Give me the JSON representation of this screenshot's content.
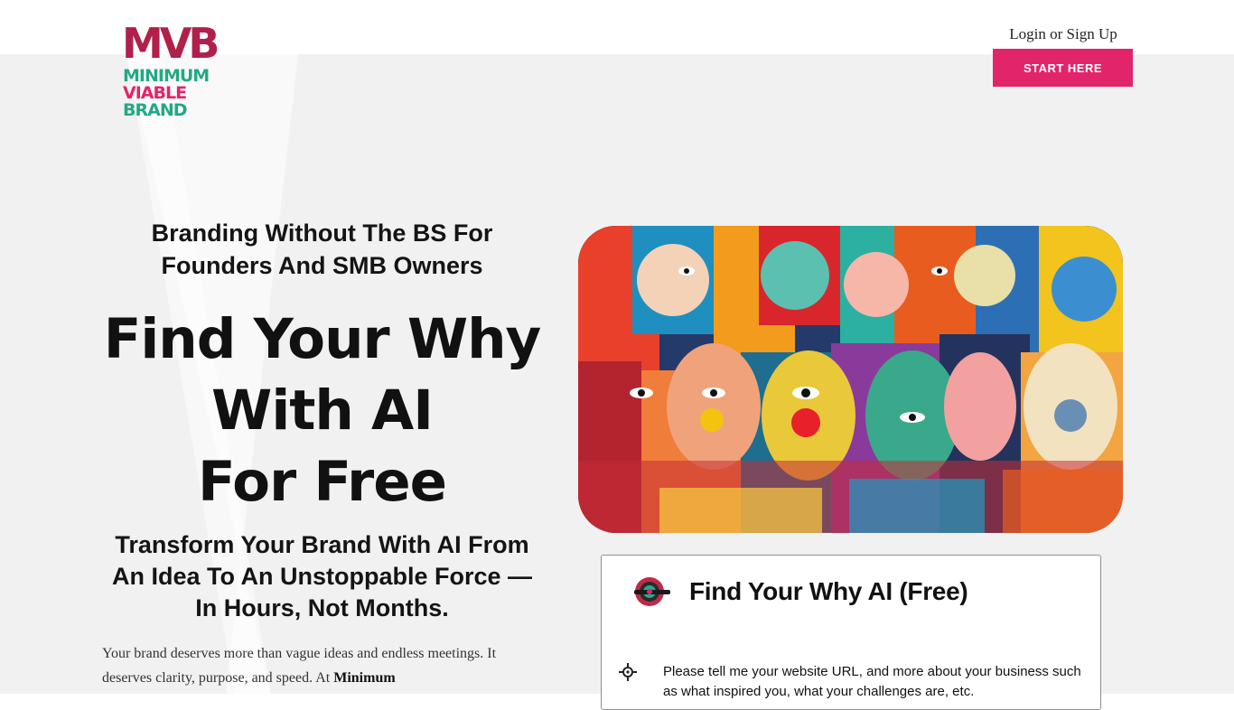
{
  "brand": {
    "logo_mvb": "MVB",
    "logo_line1": "MINIMUM",
    "logo_line2": "VIABLE",
    "logo_line3": "BRAND"
  },
  "header": {
    "login_label": "Login or Sign Up",
    "start_label": "START HERE"
  },
  "hero": {
    "subheadline": "Branding Without The BS For Founders And SMB Owners",
    "headline_line1": "Find Your Why",
    "headline_line2": "With AI",
    "headline_line3": "For Free",
    "tagline": "Transform Your Brand With AI From An Idea To An Unstoppable Force — In Hours, Not Months.",
    "paragraph_text": "Your brand deserves more than vague ideas and endless meetings. It deserves clarity, purpose, and speed. At",
    "paragraph_bold": "Minimum"
  },
  "chat_card": {
    "title": "Find Your Why AI (Free)",
    "prompt": "Please tell me your website URL, and more about your business such as what inspired you, what your challenges are, etc."
  },
  "colors": {
    "brand_pink": "#e2246a",
    "brand_crimson": "#b1204a",
    "brand_teal": "#22a886"
  }
}
